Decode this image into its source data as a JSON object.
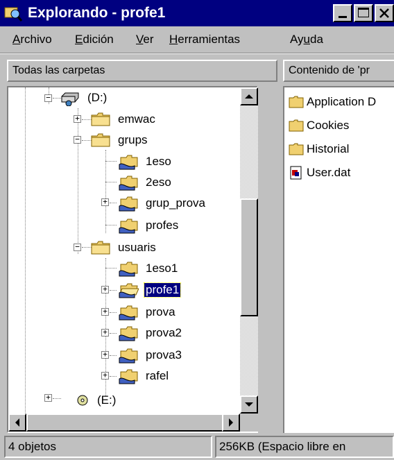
{
  "window": {
    "title": "Explorando - profe1"
  },
  "menu": [
    {
      "label": "Archivo",
      "accel": "A"
    },
    {
      "label": "Edición",
      "accel": "E"
    },
    {
      "label": "Ver",
      "accel": "V"
    },
    {
      "label": "Herramientas",
      "accel": "H"
    },
    {
      "label": "Ayuda",
      "accel": "u"
    }
  ],
  "left_header": "Todas las carpetas",
  "right_header": "Contenido de 'pr",
  "tree": {
    "drive_d": "(D:)",
    "emwac": "emwac",
    "grups": "grups",
    "g_1eso": "1eso",
    "g_2eso": "2eso",
    "grup_prova": "grup_prova",
    "profes": "profes",
    "usuaris": "usuaris",
    "u_1eso1": "1eso1",
    "profe1": "profe1",
    "prova": "prova",
    "prova2": "prova2",
    "prova3": "prova3",
    "rafel": "rafel",
    "drive_e": "(E:)"
  },
  "files": [
    {
      "name": "Application D",
      "icon": "folder-icon"
    },
    {
      "name": "Cookies",
      "icon": "folder-icon"
    },
    {
      "name": "Historial",
      "icon": "folder-icon"
    },
    {
      "name": "User.dat",
      "icon": "file-icon"
    }
  ],
  "status": {
    "objects": "4 objetos",
    "space": "256KB (Espacio libre en"
  },
  "colors": {
    "titlebar": "#000080",
    "face": "#c0c0c0",
    "selection": "#000080",
    "folder": "#f0d070"
  }
}
